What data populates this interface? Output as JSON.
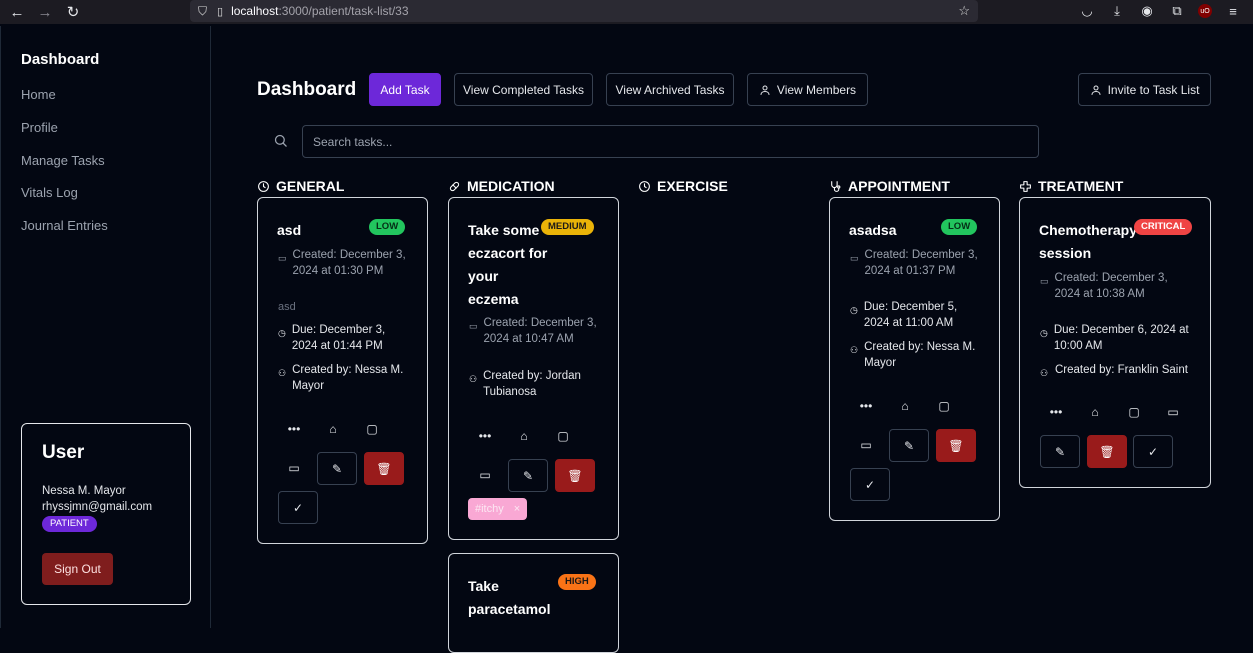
{
  "browser": {
    "url_host": "localhost",
    "url_path": ":3000/patient/task-list/33"
  },
  "sidebar": {
    "title": "Dashboard",
    "items": [
      {
        "label": "Home"
      },
      {
        "label": "Profile"
      },
      {
        "label": "Manage Tasks"
      },
      {
        "label": "Vitals Log"
      },
      {
        "label": "Journal Entries"
      }
    ],
    "user_card": {
      "title": "User",
      "name": "Nessa M. Mayor",
      "email": "rhyssjmn@gmail.com",
      "role": "PATIENT",
      "sign_out_label": "Sign Out"
    }
  },
  "header": {
    "title": "Dashboard",
    "add_task_label": "Add Task",
    "view_completed_label": "View Completed Tasks",
    "view_archived_label": "View Archived Tasks",
    "view_members_label": "View Members",
    "invite_label": "Invite to Task List"
  },
  "search": {
    "placeholder": "Search tasks..."
  },
  "columns": [
    {
      "label": "GENERAL",
      "icon": "clock-icon"
    },
    {
      "label": "MEDICATION",
      "icon": "pill-icon"
    },
    {
      "label": "EXERCISE",
      "icon": "clock-icon"
    },
    {
      "label": "APPOINTMENT",
      "icon": "stethoscope-icon"
    },
    {
      "label": "TREATMENT",
      "icon": "cross-icon"
    }
  ],
  "cards": {
    "general_1": {
      "title": "asd",
      "priority": "LOW",
      "created": "Created: December 3, 2024 at 01:30 PM",
      "description": "asd",
      "due": "Due: December 3, 2024 at 01:44 PM",
      "created_by": "Created by: Nessa M. Mayor"
    },
    "medication_1": {
      "title": "Take some eczacort for your eczema",
      "priority": "MEDIUM",
      "created": "Created: December 3, 2024 at 10:47 AM",
      "created_by": "Created by: Jordan Tubianosa",
      "tag": "#itchy",
      "tag_remove": "×"
    },
    "medication_2": {
      "title": "Take paracetamol",
      "priority": "HIGH"
    },
    "appointment_1": {
      "title": "asadsa",
      "priority": "LOW",
      "created": "Created: December 3, 2024 at 01:37 PM",
      "due": "Due: December 5, 2024 at 11:00 AM",
      "created_by": "Created by: Nessa M. Mayor"
    },
    "treatment_1": {
      "title": "Chemotherapy session",
      "priority": "CRITICAL",
      "created": "Created: December 3, 2024 at 10:38 AM",
      "due": "Due: December 6, 2024 at 10:00 AM",
      "created_by": "Created by: Franklin Saint"
    }
  },
  "colors": {
    "accent": "#6d28d9",
    "danger": "#991b1b",
    "low": "#22c55e",
    "medium": "#eab308",
    "high": "#f97316",
    "critical": "#ef4444",
    "tag": "#f9a8d4"
  }
}
